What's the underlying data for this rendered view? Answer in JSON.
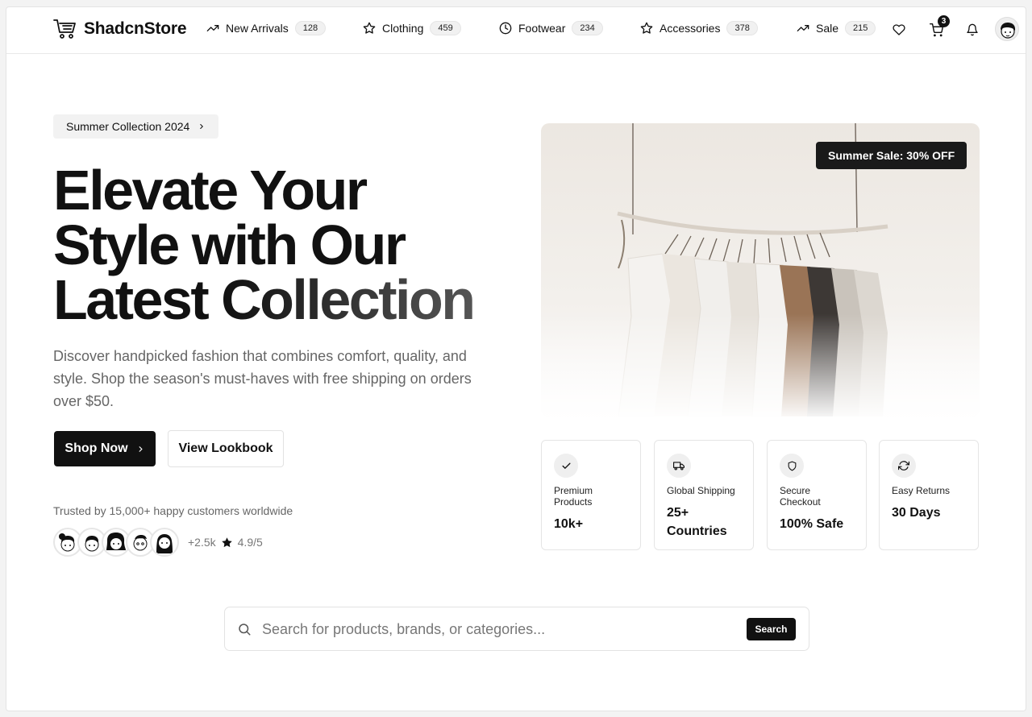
{
  "header": {
    "brand": "ShadcnStore",
    "nav": [
      {
        "label": "New Arrivals",
        "count": "128",
        "icon": "trending-up-icon"
      },
      {
        "label": "Clothing",
        "count": "459",
        "icon": "star-icon"
      },
      {
        "label": "Footwear",
        "count": "234",
        "icon": "clock-icon"
      },
      {
        "label": "Accessories",
        "count": "378",
        "icon": "star-icon"
      },
      {
        "label": "Sale",
        "count": "215",
        "icon": "trending-up-icon"
      }
    ],
    "cart_count": "3"
  },
  "hero": {
    "pill": "Summer Collection 2024",
    "headline_line1": "Elevate Your",
    "headline_line2": "Style with Our",
    "headline_line3a": "Latest",
    "headline_line3b": "Collection",
    "subtitle": "Discover handpicked fashion that combines comfort, quality, and style. Shop the season's must-haves with free shipping on orders over $50.",
    "primary_button": "Shop Now",
    "secondary_button": "View Lookbook",
    "trusted": "Trusted by 15,000+ happy customers worldwide",
    "extra_count": "+2.5k",
    "rating": "4.9/5",
    "sale_tag": "Summer Sale: 30% OFF"
  },
  "features": [
    {
      "title": "Premium Products",
      "value": "10k+",
      "icon": "check-icon"
    },
    {
      "title": "Global Shipping",
      "value": "25+ Countries",
      "icon": "truck-icon"
    },
    {
      "title": "Secure Checkout",
      "value": "100% Safe",
      "icon": "shield-icon"
    },
    {
      "title": "Easy Returns",
      "value": "30 Days",
      "icon": "refresh-icon"
    }
  ],
  "search": {
    "placeholder": "Search for products, brands, or categories...",
    "button": "Search"
  },
  "colors": {
    "primary": "#111111",
    "muted_text": "#666666",
    "border": "#e5e5e5"
  }
}
